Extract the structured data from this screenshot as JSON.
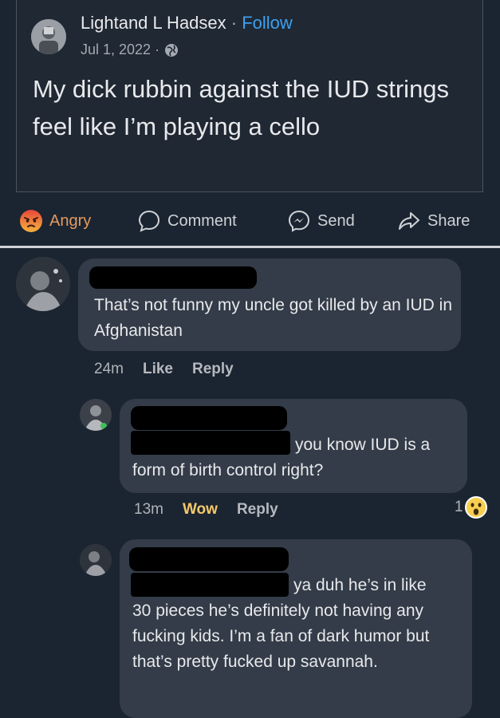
{
  "post": {
    "author": "Lightand L Hadsex",
    "separator": " · ",
    "follow_label": "Follow",
    "date": "Jul 1, 2022 ·",
    "text": "My dick rubbin against the IUD strings feel like I’m playing a cello"
  },
  "actions": {
    "angry": "Angry",
    "comment": "Comment",
    "send": "Send",
    "share": "Share"
  },
  "comments": [
    {
      "text": "That’s not funny my uncle got killed by an IUD in Afghanistan",
      "time": "24m",
      "like": "Like",
      "reply": "Reply"
    },
    {
      "text_line1": "you know IUD is a",
      "text_line2": "form of birth control right?",
      "time": "13m",
      "reaction": "Wow",
      "reply": "Reply",
      "reaction_count": "1"
    },
    {
      "text_line1": "ya duh he’s in like",
      "text_rest": "30 pieces he’s definitely not having any fucking kids. I’m a fan of dark humor but that’s pretty fucked up savannah."
    }
  ],
  "colors": {
    "background": "#1b2531",
    "bubble": "#333c48",
    "follow": "#3ea0f0",
    "angry": "#e39a5f",
    "wow": "#f5c86b"
  }
}
